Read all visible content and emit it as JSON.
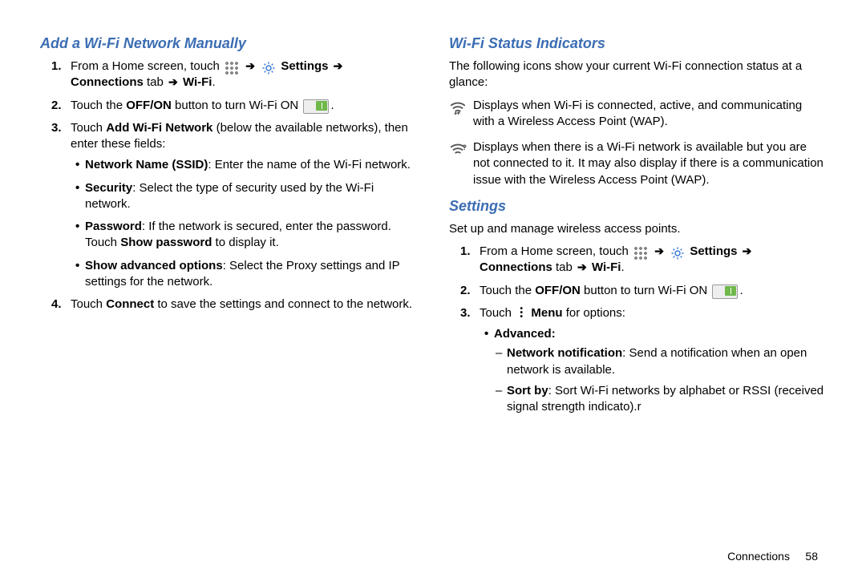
{
  "left": {
    "heading": "Add a Wi-Fi Network Manually",
    "step1_a": "From a Home screen, touch ",
    "step1_b": " Settings ",
    "step1_c": " Connections",
    "step1_d": " tab ",
    "step1_e": " Wi-Fi",
    "step2_a": "Touch the ",
    "step2_b": "OFF/ON",
    "step2_c": " button to turn Wi-Fi ON ",
    "step3_a": "Touch ",
    "step3_b": "Add Wi-Fi Network",
    "step3_c": " (below the available networks), then enter these fields:",
    "b1_a": "Network Name (SSID)",
    "b1_b": ": Enter the name of the Wi-Fi network.",
    "b2_a": "Security",
    "b2_b": ": Select the type of security used by the Wi-Fi network.",
    "b3_a": "Password",
    "b3_b": ": If the network is secured, enter the password. Touch ",
    "b3_c": "Show password",
    "b3_d": " to display it.",
    "b4_a": "Show advanced options",
    "b4_b": ": Select the Proxy settings and IP settings for the network.",
    "step4_a": "Touch ",
    "step4_b": "Connect",
    "step4_c": " to save the settings and connect to the network."
  },
  "right": {
    "heading1": "Wi-Fi Status Indicators",
    "intro1": "The following icons show your current Wi-Fi connection status at a glance:",
    "wifi1": "Displays when Wi-Fi is connected, active, and communicating with a Wireless Access Point (WAP).",
    "wifi2": "Displays when there is a Wi-Fi network is available but you are not connected to it. It may also display if there is a communication issue with the Wireless Access Point (WAP).",
    "heading2": "Settings",
    "intro2": "Set up and manage wireless access points.",
    "s_step1_a": "From a Home screen, touch ",
    "s_step1_b": " Settings ",
    "s_step1_c": " Connections",
    "s_step1_d": " tab ",
    "s_step1_e": " Wi-Fi",
    "s_step2_a": "Touch the ",
    "s_step2_b": "OFF/ON",
    "s_step2_c": " button to turn Wi-Fi ON ",
    "s_step3_a": "Touch ",
    "s_step3_b": " Menu",
    "s_step3_c": " for options:",
    "adv_label": "Advanced:",
    "d1_a": "Network notification",
    "d1_b": ": Send a notification when an open network is available.",
    "d2_a": "Sort by",
    "d2_b": ": Sort Wi-Fi networks by alphabet or RSSI (received signal strength indicato).r"
  },
  "footer": {
    "section": "Connections",
    "page": "58"
  },
  "glyphs": {
    "arrow": "➔",
    "dot": "."
  }
}
